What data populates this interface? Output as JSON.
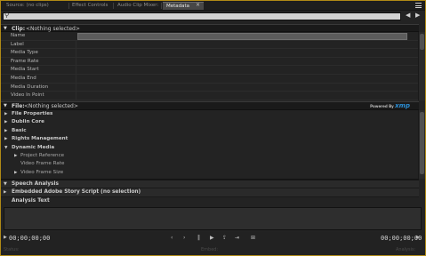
{
  "tabs": [
    {
      "label": "Source: (no clips)",
      "active": false
    },
    {
      "label": "Effect Controls",
      "active": false
    },
    {
      "label": "Audio Clip Mixer:",
      "active": false
    },
    {
      "label": "Metadata",
      "active": true
    }
  ],
  "search": {
    "value": "",
    "placeholder": ""
  },
  "clip": {
    "label": "Clip:",
    "value": "<Nothing selected>",
    "fields": [
      "Name",
      "Label",
      "Media Type",
      "Frame Rate",
      "Media Start",
      "Media End",
      "Media Duration",
      "Video In Point"
    ]
  },
  "file": {
    "label": "File:",
    "value": "<Nothing selected>",
    "powered_by": "Powered By",
    "xmp": "xmp",
    "sections": [
      {
        "label": "File Properties",
        "level": 0,
        "expanded": false
      },
      {
        "label": "Dublin Core",
        "level": 0,
        "expanded": false
      },
      {
        "label": "Basic",
        "level": 0,
        "expanded": false
      },
      {
        "label": "Rights Management",
        "level": 0,
        "expanded": false
      },
      {
        "label": "Dynamic Media",
        "level": 0,
        "expanded": true
      },
      {
        "label": "Project Reference",
        "level": 1,
        "expanded": false
      },
      {
        "label": "Video Frame Rate",
        "level": 1,
        "expanded": null
      },
      {
        "label": "Video Frame Size",
        "level": 1,
        "expanded": false
      }
    ]
  },
  "speech": {
    "label": "Speech Analysis",
    "story_script": "Embedded Adobe Story Script (no selection)",
    "analysis_text": "Analysis Text"
  },
  "transport": {
    "timecode_in": "00;00;00;00",
    "timecode_out": "00;00;00;00",
    "status_left": "Status:",
    "status_mid": "Embed:",
    "status_right": "Analysis:"
  },
  "colors": {
    "accent_border": "#b08a16",
    "xmp_blue": "#2b8fd6"
  }
}
